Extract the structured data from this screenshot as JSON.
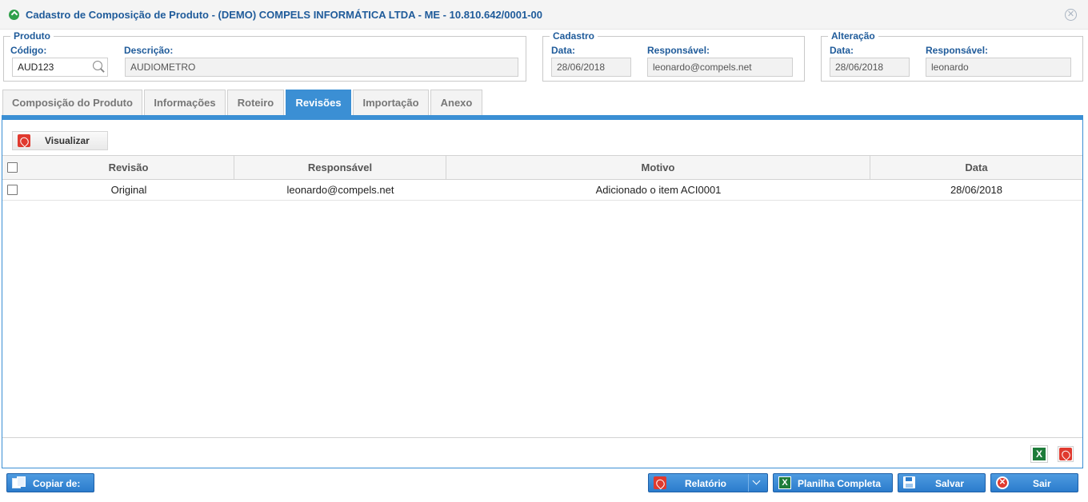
{
  "window": {
    "title": "Cadastro de Composição de Produto - (DEMO) COMPELS INFORMÁTICA LTDA - ME - 10.810.642/0001-00"
  },
  "produto": {
    "legend": "Produto",
    "codigo_label": "Código:",
    "codigo_value": "AUD123",
    "descricao_label": "Descrição:",
    "descricao_value": "AUDIOMETRO"
  },
  "cadastro": {
    "legend": "Cadastro",
    "data_label": "Data:",
    "data_value": "28/06/2018",
    "responsavel_label": "Responsável:",
    "responsavel_value": "leonardo@compels.net"
  },
  "alteracao": {
    "legend": "Alteração",
    "data_label": "Data:",
    "data_value": "28/06/2018",
    "responsavel_label": "Responsável:",
    "responsavel_value": "leonardo"
  },
  "tabs": [
    {
      "label": "Composição do Produto"
    },
    {
      "label": "Informações"
    },
    {
      "label": "Roteiro"
    },
    {
      "label": "Revisões",
      "active": true
    },
    {
      "label": "Importação"
    },
    {
      "label": "Anexo"
    }
  ],
  "toolbar": {
    "visualizar_label": "Visualizar"
  },
  "table": {
    "columns": [
      "Revisão",
      "Responsável",
      "Motivo",
      "Data"
    ],
    "rows": [
      {
        "revisao": "Original",
        "responsavel": "leonardo@compels.net",
        "motivo": "Adicionado o item ACI0001",
        "data": "28/06/2018"
      }
    ]
  },
  "footer": {
    "copiar_label": "Copiar de:",
    "relatorio_label": "Relatório",
    "planilha_label": "Planilha Completa",
    "salvar_label": "Salvar",
    "sair_label": "Sair",
    "xls_glyph": "X"
  },
  "colors": {
    "accent": "#3b8fd4",
    "label": "#1f5b9a",
    "button": "#2b7ccc",
    "excel": "#1e7c3a",
    "pdf": "#e03a2f"
  }
}
